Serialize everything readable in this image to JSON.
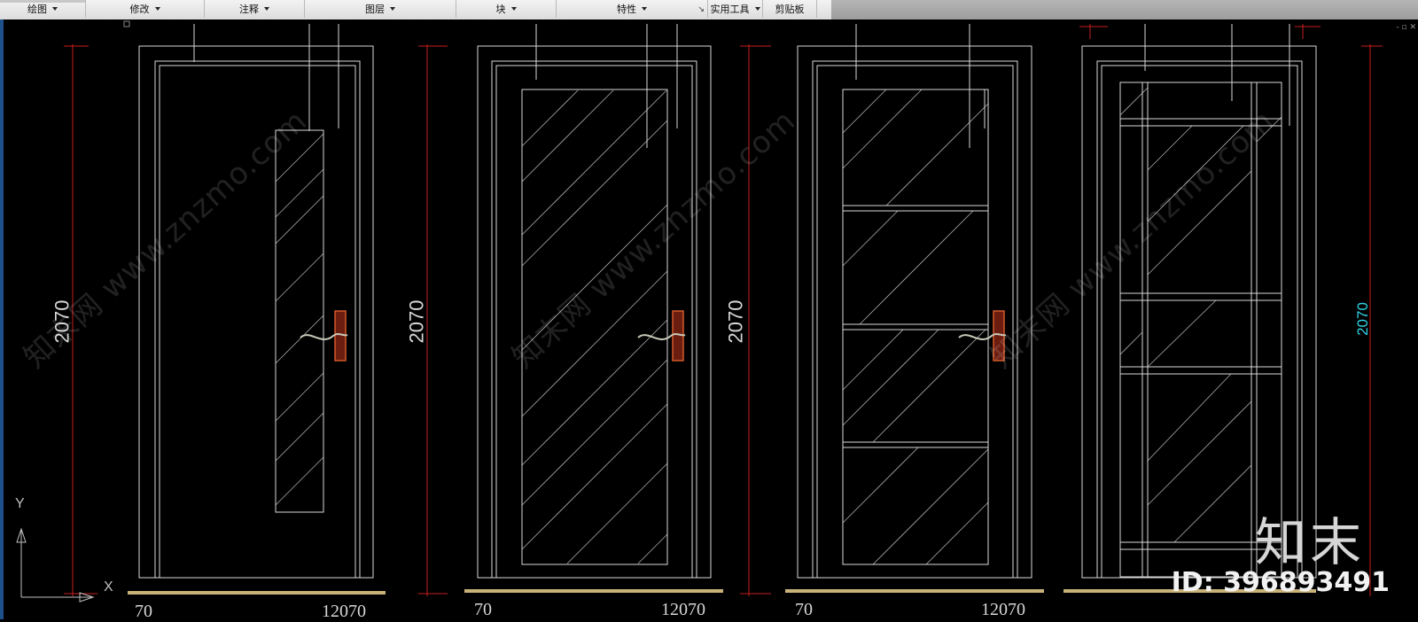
{
  "ribbon": {
    "panels": [
      {
        "label": "绘图",
        "has_dropdown": true
      },
      {
        "label": "修改",
        "has_dropdown": true
      },
      {
        "label": "注释",
        "has_dropdown": true
      },
      {
        "label": "图层",
        "has_dropdown": true
      },
      {
        "label": "块",
        "has_dropdown": true
      },
      {
        "label": "特性",
        "has_dropdown": true
      },
      {
        "label": "实用工具",
        "has_dropdown": true
      },
      {
        "label": "剪贴板",
        "has_dropdown": false
      }
    ],
    "launcher_icon": "panel-launcher-icon"
  },
  "drawing": {
    "dimension_labels": [
      "2070",
      "2070",
      "2070",
      "2070"
    ],
    "bottom_labels": [
      {
        "left": "70",
        "right": "12070"
      },
      {
        "left": "70",
        "right": "12070"
      },
      {
        "left": "70",
        "right": "12070"
      }
    ],
    "ucs": {
      "x_label": "X",
      "y_label": "Y"
    },
    "watermark_text": "知末网 www.znzmo.com",
    "colors": {
      "background": "#000000",
      "lines": "#d8d8d8",
      "dimension": "#c81e1e",
      "handle": "#d25a2a",
      "cyan_dim": "#2fd3e6",
      "floor": "#c9b27a"
    }
  },
  "brand": {
    "name": "知末",
    "id_text": "ID: 396893491"
  }
}
